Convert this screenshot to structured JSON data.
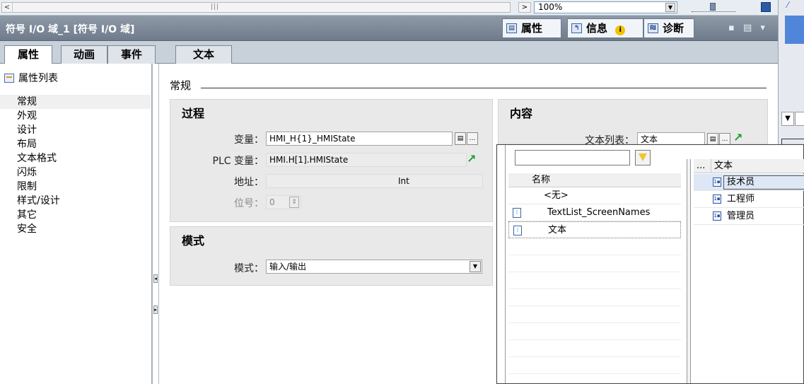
{
  "toolbar": {
    "zoom_value": "100%"
  },
  "titlebar": {
    "title": "符号 I/O 域_1 [符号 I/O 域]",
    "tabs": [
      {
        "label": "属性",
        "icon": "properties-icon"
      },
      {
        "label": "信息",
        "icon": "info-icon"
      },
      {
        "label": "诊断",
        "icon": "diagnostics-icon"
      }
    ]
  },
  "tabs": [
    "属性",
    "动画",
    "事件",
    "文本"
  ],
  "sidebar": {
    "heading": "属性列表",
    "items": [
      "常规",
      "外观",
      "设计",
      "布局",
      "文本格式",
      "闪烁",
      "限制",
      "样式/设计",
      "其它",
      "安全"
    ],
    "selected": "常规"
  },
  "main": {
    "section_title": "常规",
    "process": {
      "title": "过程",
      "variable_label": "变量：",
      "variable_value": "HMI_H{1}_HMIState",
      "plc_variable_label": "PLC 变量：",
      "plc_variable_value": "HMI.H[1].HMIState",
      "address_label": "地址：",
      "address_type": "Int",
      "bit_label": "位号：",
      "bit_value": "0"
    },
    "mode": {
      "title": "模式",
      "mode_label": "模式：",
      "mode_value": "输入/输出"
    },
    "content": {
      "title": "内容",
      "textlist_label": "文本列表：",
      "textlist_value": "文本"
    }
  },
  "popup": {
    "search_value": "",
    "list_header": "名称",
    "list_items": [
      "<无>",
      "TextList_ScreenNames",
      "文本"
    ],
    "entries_header_dots": "...",
    "entries_header": "文本",
    "entries": [
      "技术员",
      "工程师",
      "管理员"
    ]
  },
  "colors": {
    "titlebar": "#7f8a99",
    "accent": "#4f86d9",
    "selection": "#dde7f5"
  }
}
